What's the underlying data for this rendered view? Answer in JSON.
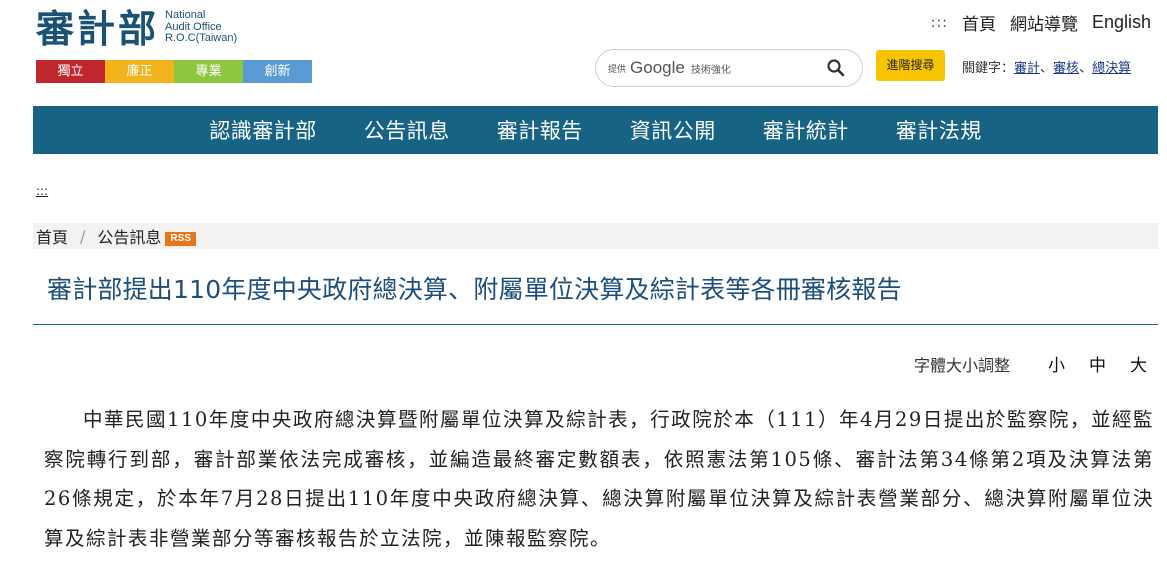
{
  "header": {
    "logo_cn": "審計部",
    "logo_en": [
      "National",
      "Audit Office",
      "R.O.C(Taiwan)"
    ],
    "tags": [
      "獨立",
      "廉正",
      "專業",
      "創新"
    ],
    "top_links": {
      "accesskey": ":::",
      "home": "首頁",
      "sitemap": "網站導覽",
      "english": "English"
    },
    "search": {
      "prefix": "提供",
      "brand": "Google",
      "suffix": "技術強化",
      "placeholder": ""
    },
    "advanced_search": "進階搜尋",
    "keywords": {
      "label": "關鍵字：",
      "items": [
        "審計",
        "審核",
        "總決算"
      ],
      "separator": "、"
    }
  },
  "nav": {
    "items": [
      "認識審計部",
      "公告訊息",
      "審計報告",
      "資訊公開",
      "審計統計",
      "審計法規"
    ]
  },
  "accesskey_center": ":::",
  "breadcrumb": {
    "home": "首頁",
    "separator": "/",
    "current": "公告訊息",
    "rss": "RSS"
  },
  "article": {
    "title": "審計部提出110年度中央政府總決算、附屬單位決算及綜計表等各冊審核報告",
    "font_size": {
      "label": "字體大小調整",
      "small": "小",
      "medium": "中",
      "large": "大"
    },
    "body": "中華民國110年度中央政府總決算暨附屬單位決算及綜計表，行政院於本（111）年4月29日提出於監察院，並經監察院轉行到部，審計部業依法完成審核，並編造最終審定數額表，依照憲法第105條、審計法第34條第2項及決算法第26條規定，於本年7月28日提出110年度中央政府總決算、總決算附屬單位決算及綜計表營業部分、總決算附屬單位決算及綜計表非營業部分等審核報告於立法院，並陳報監察院。"
  },
  "colors": {
    "primary": "#166383",
    "title": "#1c4f7a",
    "tag_red": "#c0272d",
    "tag_yellow": "#f2b31c",
    "tag_green": "#8dc63f",
    "tag_blue": "#5b9bd5",
    "advanced_button": "#f7c500",
    "rss": "#e8751a"
  }
}
